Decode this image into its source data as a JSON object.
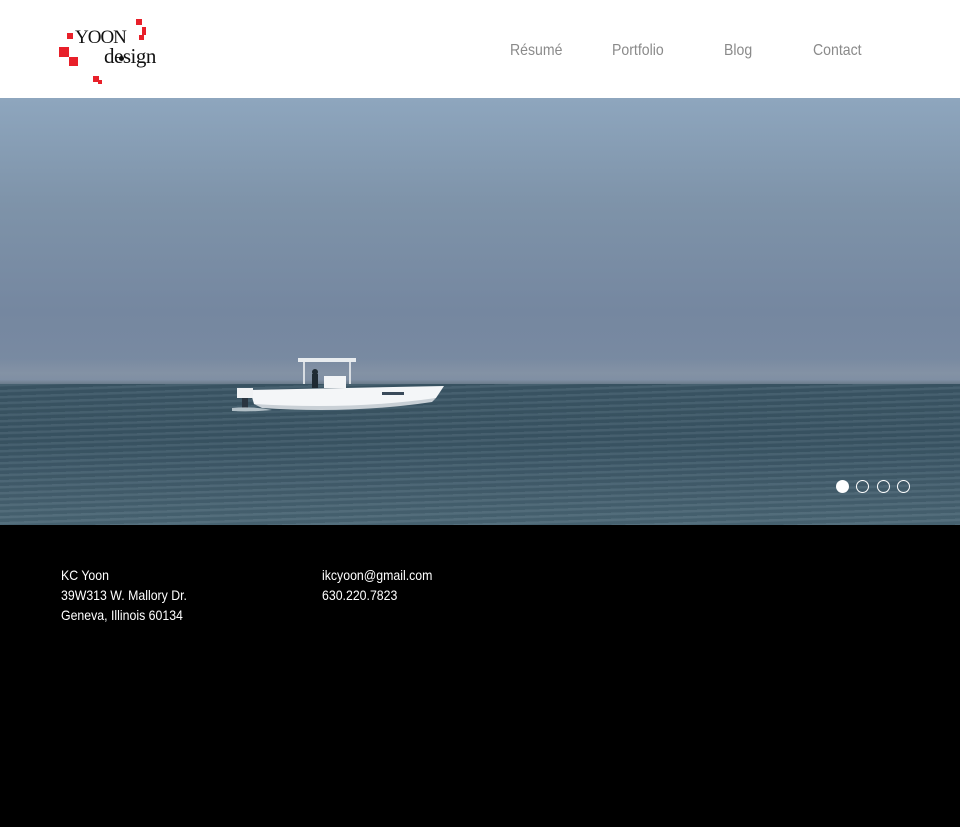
{
  "brand": {
    "logo_line1": "YOON",
    "logo_line2": "design",
    "accent_color": "#e8202a"
  },
  "nav": {
    "items": [
      {
        "label": "Résumé"
      },
      {
        "label": "Portfolio"
      },
      {
        "label": "Blog"
      },
      {
        "label": "Contact"
      }
    ]
  },
  "hero": {
    "slide_count": 4,
    "active_slide": 1
  },
  "footer": {
    "address": {
      "name": "KC Yoon",
      "street": "39W313 W. Mallory Dr.",
      "city": "Geneva, Illinois 60134"
    },
    "contact": {
      "email": "ikcyoon@gmail.com",
      "phone": "630.220.7823"
    }
  }
}
